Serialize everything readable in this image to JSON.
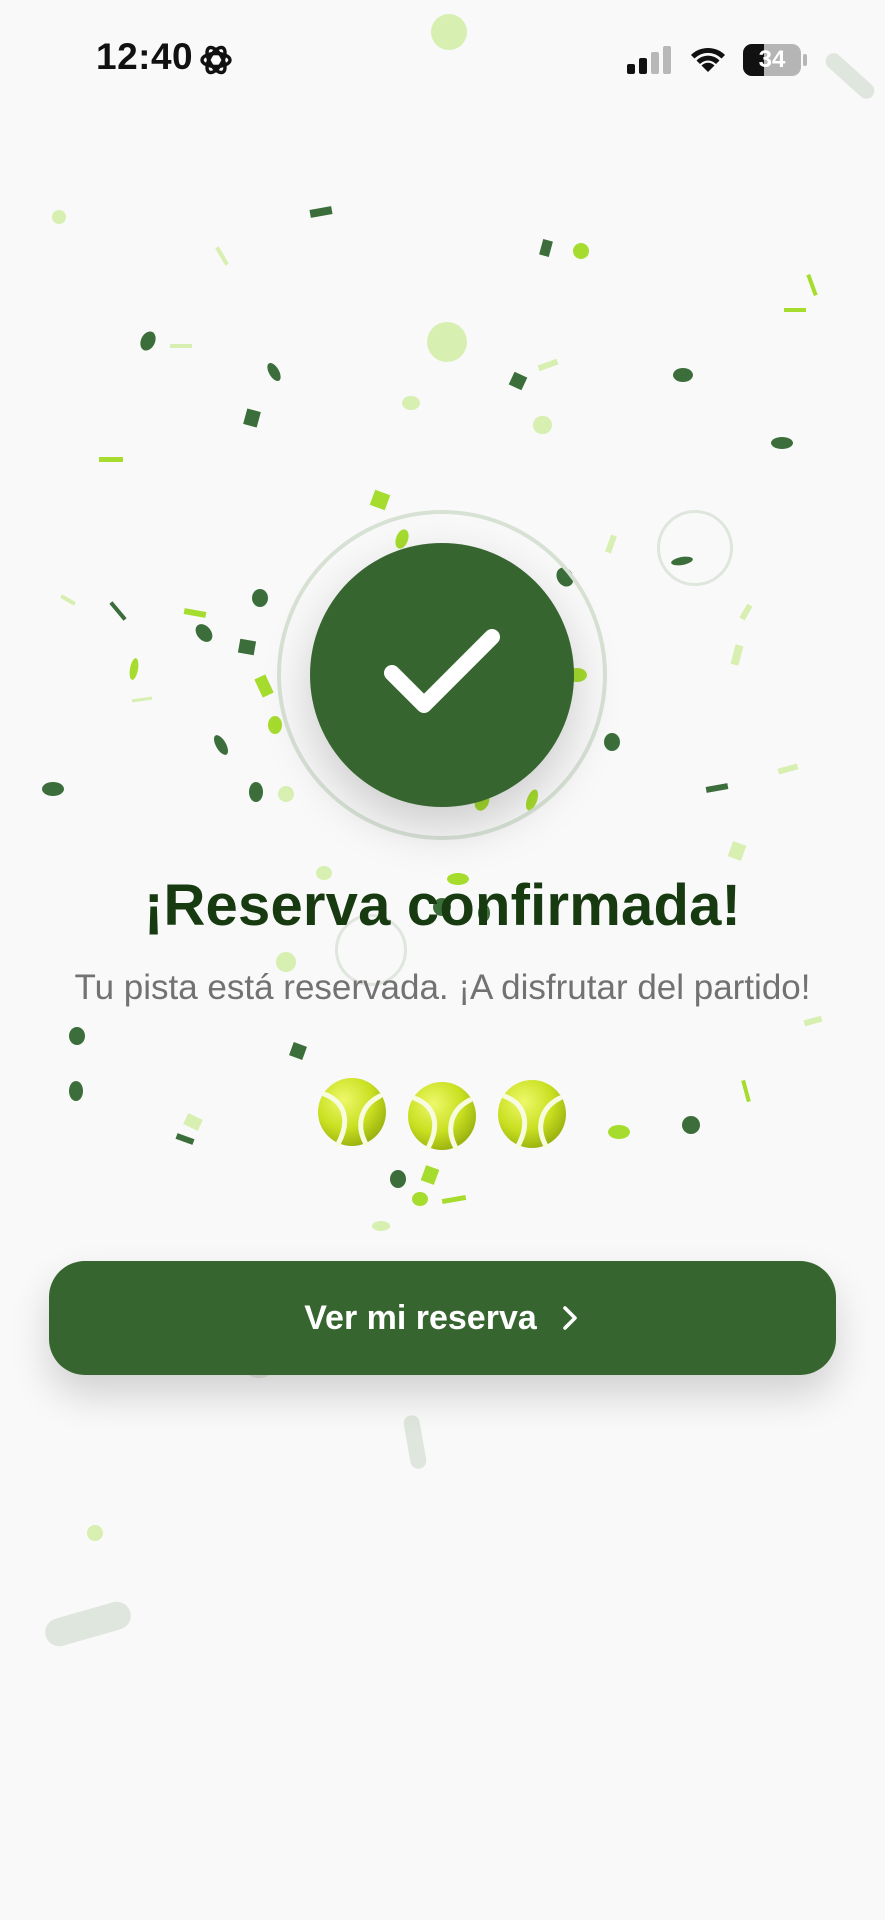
{
  "status_bar": {
    "time": "12:40",
    "battery": "34",
    "icons": [
      "gear-icon",
      "signal-icon",
      "wifi-icon",
      "battery-icon"
    ]
  },
  "success": {
    "icon": "checkmark-icon",
    "title": "¡Reserva confirmada!",
    "subtitle": "Tu pista está reservada. ¡A disfrutar del partido!",
    "decoration": [
      "tennis-ball-icon",
      "tennis-ball-icon",
      "tennis-ball-icon"
    ]
  },
  "actions": {
    "primary_label": "Ver mi reserva",
    "primary_icon": "chevron-right-icon"
  },
  "colors": {
    "primary": "#36652f",
    "title": "#173a10",
    "subtitle": "#727272",
    "background": "#f9f9f9",
    "confetti_dark": "#3b6e3a",
    "confetti_lime": "#a6dc2e",
    "confetti_pale": "#d7efb0"
  }
}
